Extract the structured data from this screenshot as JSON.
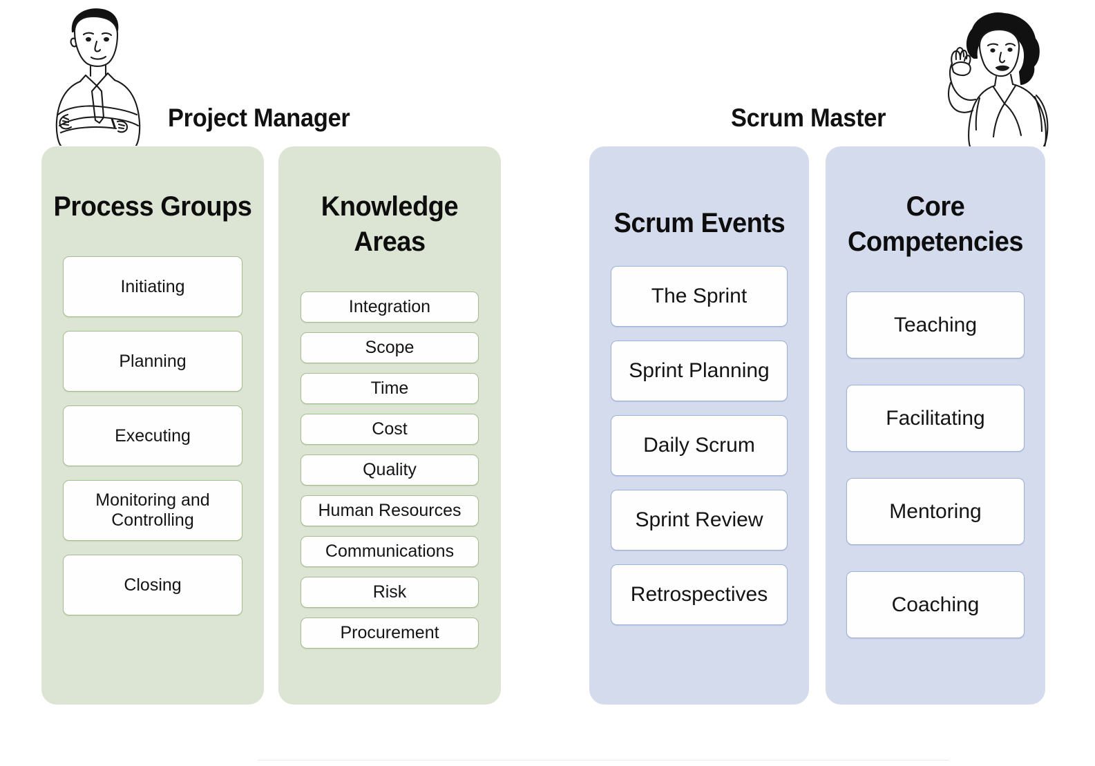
{
  "roles": [
    {
      "id": "project-manager",
      "title": "Project Manager",
      "avatar_icon": "person-arms-crossed-icon",
      "theme": "green",
      "panel_color": "#dce5d3",
      "card_border_color": "#a8bd8e",
      "columns": [
        {
          "id": "process-groups",
          "heading": "Process Groups",
          "items": [
            "Initiating",
            "Planning",
            "Executing",
            "Monitoring and Controlling",
            "Closing"
          ]
        },
        {
          "id": "knowledge-areas",
          "heading": "Knowledge Areas",
          "items": [
            "Integration",
            "Scope",
            "Time",
            "Cost",
            "Quality",
            "Human Resources",
            "Communications",
            "Risk",
            "Procurement"
          ]
        }
      ]
    },
    {
      "id": "scrum-master",
      "title": "Scrum Master",
      "avatar_icon": "person-raised-hand-icon",
      "theme": "blue",
      "panel_color": "#d4dbed",
      "card_border_color": "#9cb2d8",
      "columns": [
        {
          "id": "scrum-events",
          "heading": "Scrum Events",
          "items": [
            "The Sprint",
            "Sprint Planning",
            "Daily Scrum",
            "Sprint Review",
            "Retrospectives"
          ]
        },
        {
          "id": "core-competencies",
          "heading": "Core Competencies",
          "items": [
            "Teaching",
            "Facilitating",
            "Mentoring",
            "Coaching"
          ]
        }
      ]
    }
  ],
  "background_color": "#ffffff"
}
